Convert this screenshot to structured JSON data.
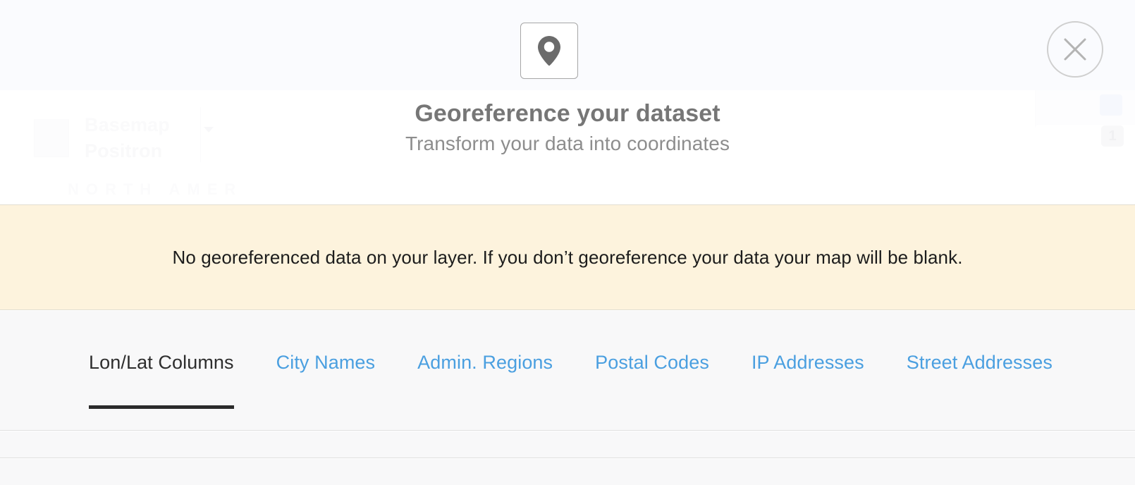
{
  "backdrop": {
    "basemap_label": "Basemap",
    "basemap_value": "Positron",
    "continent_label": "NORTH AMER",
    "layer_badge": "1",
    "thumb_icon": "basemap-thumbnail-icon",
    "caret_icon": "chevron-down-icon"
  },
  "header": {
    "pin_icon": "map-pin-icon",
    "close_icon": "close-icon",
    "title": "Georeference your dataset",
    "subtitle": "Transform your data into coordinates"
  },
  "warning": {
    "message": "No georeferenced data on your layer. If you don’t georeference your data your map will be blank.",
    "background_color": "#fdf3dd"
  },
  "tabs": {
    "accent_color": "#4a9fe0",
    "active_color": "#2e2e2e",
    "items": [
      {
        "label": "Lon/Lat Columns",
        "active": true
      },
      {
        "label": "City Names",
        "active": false
      },
      {
        "label": "Admin. Regions",
        "active": false
      },
      {
        "label": "Postal Codes",
        "active": false
      },
      {
        "label": "IP Addresses",
        "active": false
      },
      {
        "label": "Street Addresses",
        "active": false
      }
    ]
  }
}
